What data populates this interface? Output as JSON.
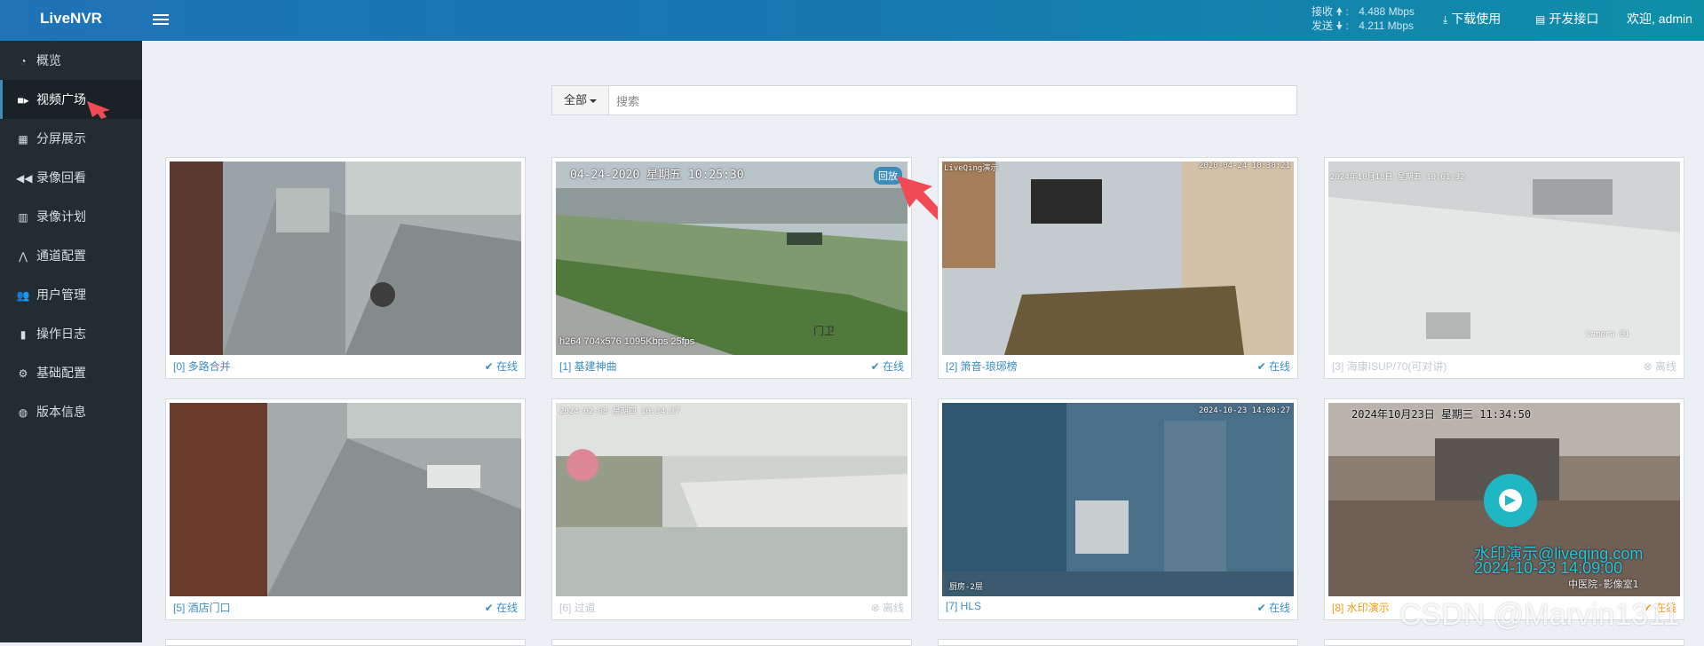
{
  "app": {
    "title": "LiveNVR"
  },
  "topbar": {
    "recv_label": "接收",
    "send_label": "发送",
    "recv_value": "4.488 Mbps",
    "send_value": "4.211 Mbps",
    "download": "下载使用",
    "api": "开发接口",
    "welcome": "欢迎, admin"
  },
  "sidebar": {
    "items": [
      {
        "label": "概览",
        "icon": "dashboard-icon"
      },
      {
        "label": "视频广场",
        "icon": "video-camera-icon"
      },
      {
        "label": "分屏展示",
        "icon": "grid-icon"
      },
      {
        "label": "录像回看",
        "icon": "rewind-icon"
      },
      {
        "label": "录像计划",
        "icon": "calendar-icon"
      },
      {
        "label": "通道配置",
        "icon": "road-icon"
      },
      {
        "label": "用户管理",
        "icon": "users-icon"
      },
      {
        "label": "操作日志",
        "icon": "file-icon"
      },
      {
        "label": "基础配置",
        "icon": "gears-icon"
      },
      {
        "label": "版本信息",
        "icon": "globe-icon"
      }
    ],
    "active_index": 1
  },
  "search": {
    "filter_label": "全部",
    "placeholder": "搜索",
    "value": ""
  },
  "channels": [
    {
      "caption": "[0] 多路合并",
      "status": "在线"
    },
    {
      "caption": "[1] 基建神曲",
      "status": "在线",
      "overlay_time": "04-24-2020 星期五 10:25:30",
      "overlay_info": "h264 704x576 1095Kbps 25fps",
      "badge": "回放",
      "scene_text": "门卫"
    },
    {
      "caption": "[2] 箫音-琅琊榜",
      "status": "在线",
      "overlay_left": "LiveQing演示",
      "overlay_right": "2020-04-24 10:30:21"
    },
    {
      "caption": "[3] 海康ISUP/70(可对讲)",
      "status": "离线",
      "overlay_time": "2024年10月18日 星期五 10:01:32",
      "overlay_cam": "Camera 01"
    },
    {
      "caption": "[5] 酒店门口",
      "status": "在线"
    },
    {
      "caption": "[6] 过道",
      "status": "离线",
      "overlay_time": "2024-02-08 星期四 10:34:37"
    },
    {
      "caption": "[7] HLS",
      "status": "在线",
      "overlay_right": "2024-10-23 14:08:27",
      "overlay_left": "厨房-2层"
    },
    {
      "caption": "[8] 水印演示",
      "status": "在线",
      "overlay_time": "2024年10月23日 星期三 11:34:50",
      "wm_line1": "水印演示@liveqing.com",
      "wm_line2": "2024-10-23 14:09:00",
      "wm_label": "中医院-影像室1"
    }
  ],
  "watermark": "CSDN @Marvin1311"
}
